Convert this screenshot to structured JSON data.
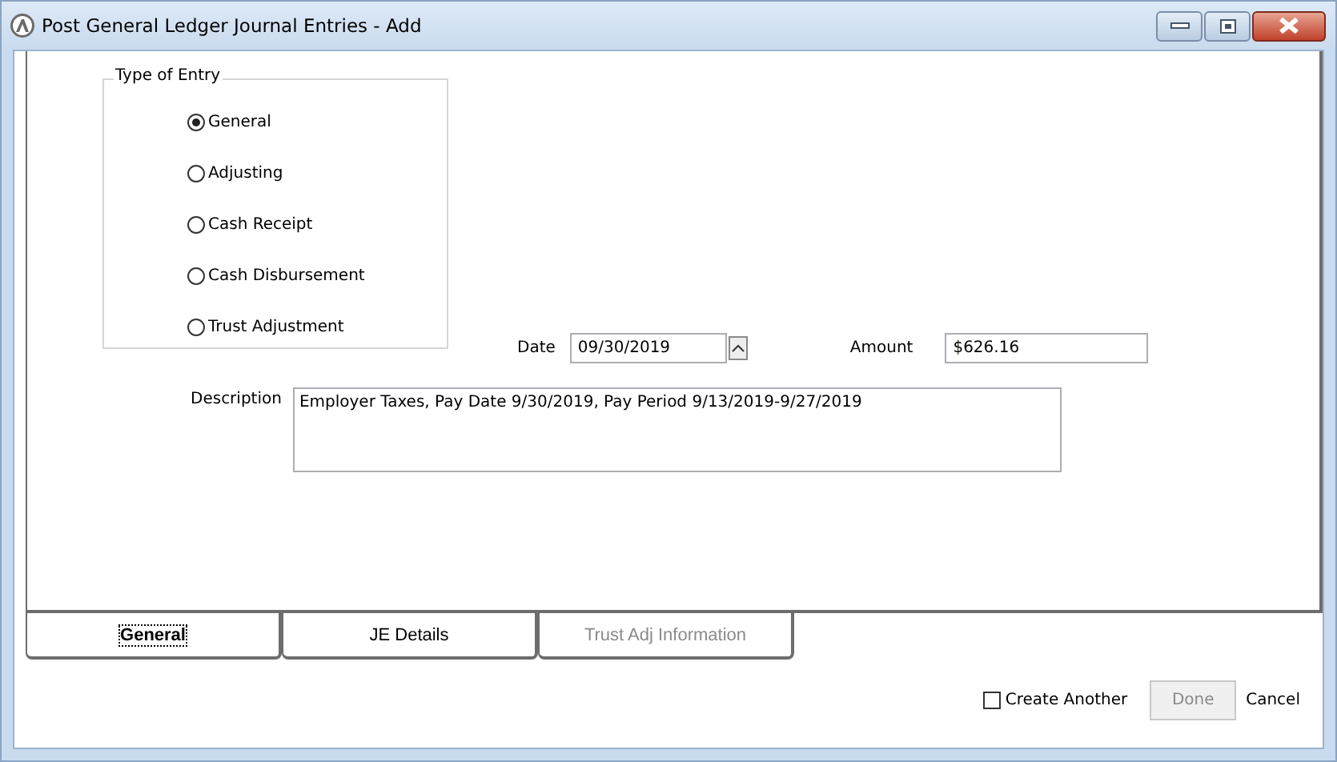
{
  "window": {
    "title": "Post General Ledger Journal Entries - Add"
  },
  "type_of_entry": {
    "label": "Type of Entry",
    "options": [
      {
        "label": "General",
        "selected": true
      },
      {
        "label": "Adjusting",
        "selected": false
      },
      {
        "label": "Cash Receipt",
        "selected": false
      },
      {
        "label": "Cash Disbursement",
        "selected": false
      },
      {
        "label": "Trust Adjustment",
        "selected": false
      }
    ]
  },
  "date": {
    "label": "Date",
    "value": "09/30/2019"
  },
  "amount": {
    "label": "Amount",
    "value": "$626.16"
  },
  "description": {
    "label": "Description",
    "value": "Employer Taxes, Pay Date 9/30/2019, Pay Period 9/13/2019-9/27/2019"
  },
  "tabs": [
    {
      "label": "General",
      "selected": true,
      "disabled": false
    },
    {
      "label": "JE Details",
      "selected": false,
      "disabled": false
    },
    {
      "label": "Trust Adj Information",
      "selected": false,
      "disabled": true
    }
  ],
  "create_another": {
    "label": "Create Another",
    "checked": false
  },
  "buttons": [
    {
      "kind": "button",
      "label": "Done",
      "disabled": true
    },
    {
      "kind": "link",
      "label": "Cancel",
      "disabled": false
    }
  ]
}
